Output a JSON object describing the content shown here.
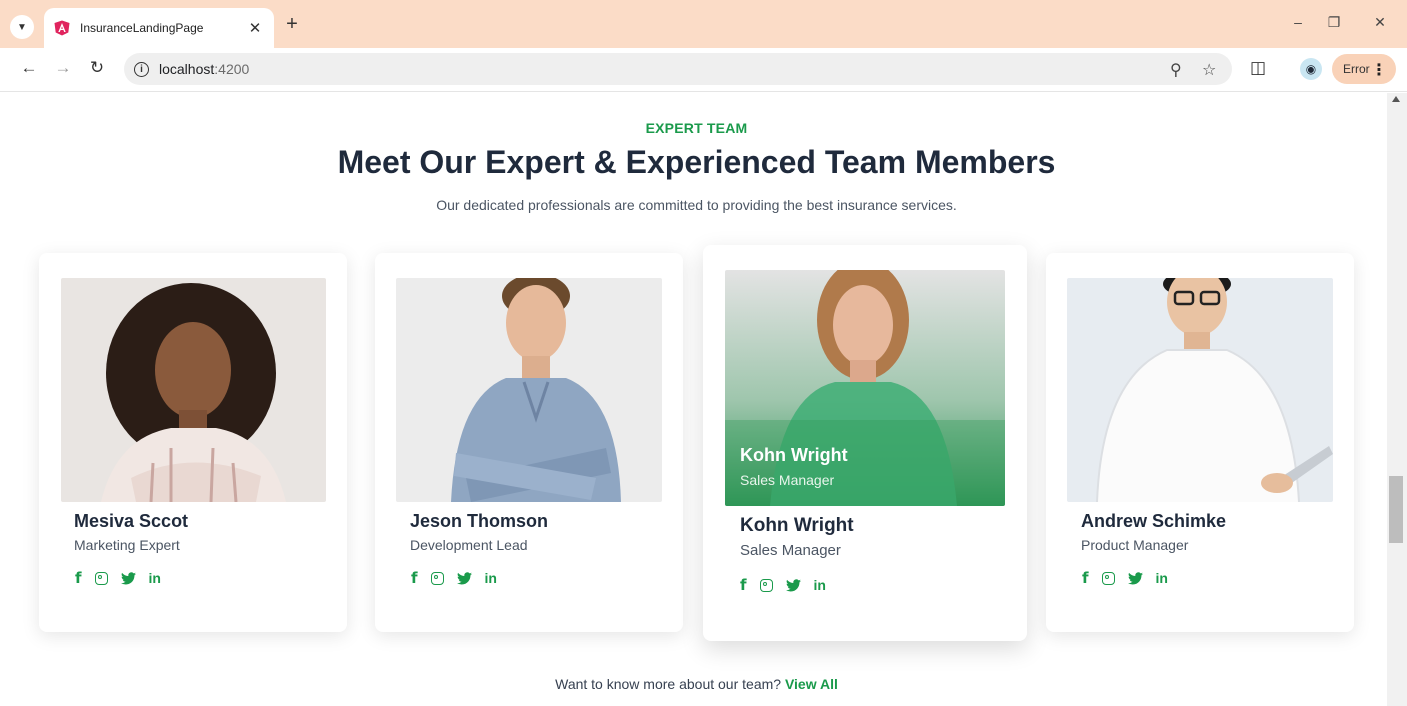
{
  "browser": {
    "tab_title": "InsuranceLandingPage",
    "url_host": "localhost",
    "url_port": ":4200",
    "error_label": "Error"
  },
  "section": {
    "eyebrow": "EXPERT TEAM",
    "heading": "Meet Our Expert & Experienced Team Members",
    "subtitle": "Our dedicated professionals are committed to providing the best insurance services."
  },
  "team": [
    {
      "name": "Mesiva Sccot",
      "role": "Marketing Expert"
    },
    {
      "name": "Jeson Thomson",
      "role": "Development Lead"
    },
    {
      "name": "Kohn Wright",
      "role": "Sales Manager",
      "overlay_name": "Kohn Wright",
      "overlay_role": "Sales Manager"
    },
    {
      "name": "Andrew Schimke",
      "role": "Product Manager"
    }
  ],
  "footer": {
    "prompt": "Want to know more about our team?",
    "link": "View All"
  },
  "colors": {
    "accent": "#1a9a4b",
    "heading": "#1f2a3c",
    "tabbar": "#fbdcc7"
  },
  "icons": [
    "facebook-icon",
    "instagram-icon",
    "twitter-icon",
    "linkedin-icon"
  ]
}
